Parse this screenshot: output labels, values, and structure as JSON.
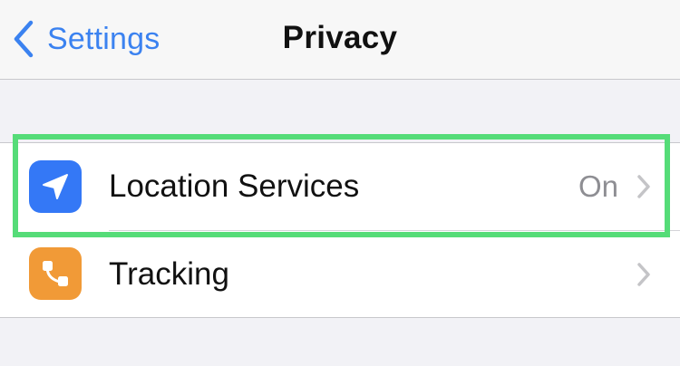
{
  "navbar": {
    "back_label": "Settings",
    "title": "Privacy"
  },
  "rows": [
    {
      "label": "Location Services",
      "value": "On",
      "icon": "location-arrow-icon",
      "icon_bg": "#3478f6"
    },
    {
      "label": "Tracking",
      "value": "",
      "icon": "tracking-icon",
      "icon_bg": "#f19a37"
    }
  ],
  "colors": {
    "accent": "#3b82f0",
    "highlight": "#55dc78",
    "background": "#f2f2f6"
  }
}
